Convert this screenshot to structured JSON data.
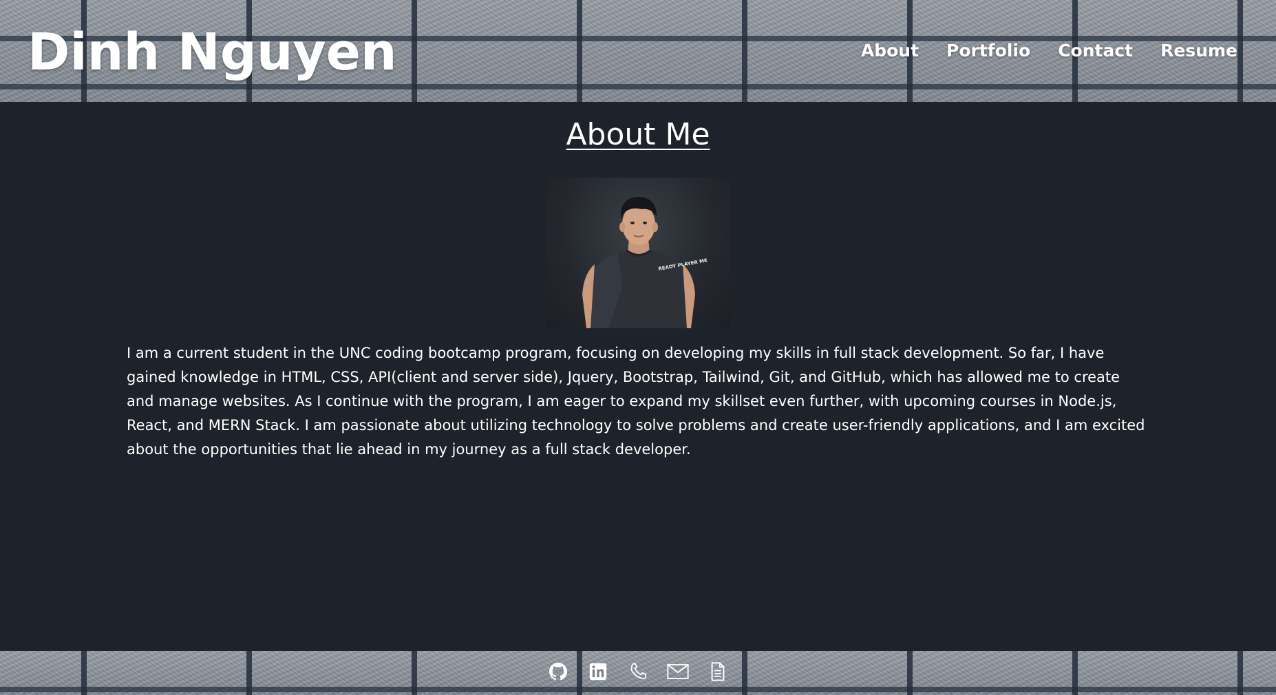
{
  "header": {
    "site_title": "Dinh Nguyen",
    "nav": [
      {
        "label": "About"
      },
      {
        "label": "Portfolio"
      },
      {
        "label": "Contact"
      },
      {
        "label": "Resume"
      }
    ]
  },
  "main": {
    "section_title": "About Me",
    "avatar": {
      "shirt_text": "READY PLAYER ME"
    },
    "bio": "I am a current student in the UNC coding bootcamp program, focusing on developing my skills in full stack development. So far, I have gained knowledge in HTML, CSS, API(client and server side), Jquery, Bootstrap, Tailwind, Git, and GitHub, which has allowed me to create and manage websites. As I continue with the program, I am eager to expand my skillset even further, with upcoming courses in Node.js, React, and MERN Stack. I am passionate about utilizing technology to solve problems and create user-friendly applications, and I am excited about the opportunities that lie ahead in my journey as a full stack developer."
  },
  "footer": {
    "icons": [
      "github-icon",
      "linkedin-icon",
      "phone-icon",
      "email-icon",
      "resume-document-icon"
    ]
  },
  "colors": {
    "page_background": "#1e232b",
    "text": "#ffffff",
    "header_footer_texture": "#8e939b"
  }
}
